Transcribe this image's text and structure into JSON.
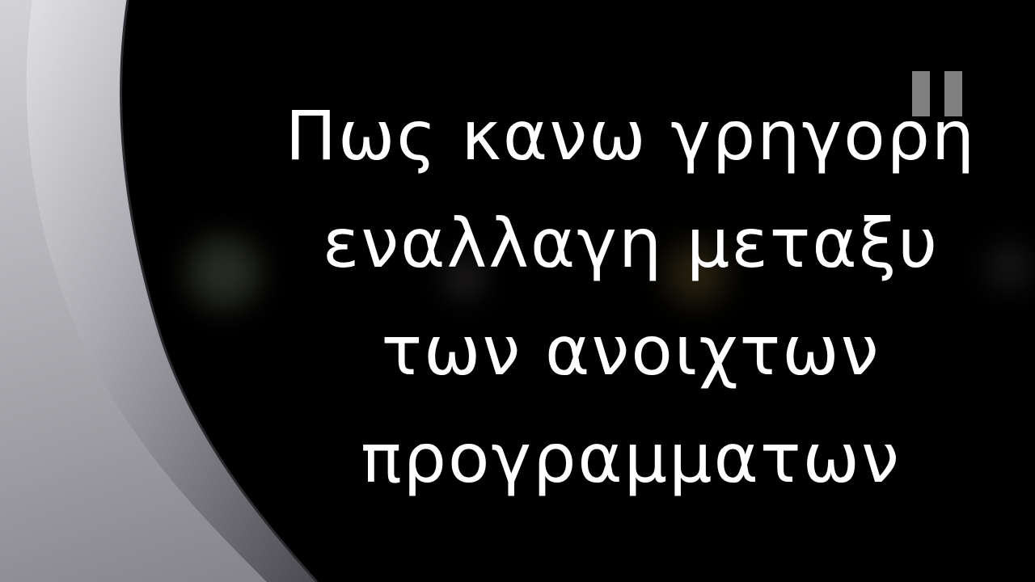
{
  "slide": {
    "title_lines": [
      "Πως κανω γρηγορη",
      "εναλλαγη μεταξυ",
      "των ανοιχτων",
      "προγραμματων"
    ]
  },
  "decor": {
    "background_color": "#000000",
    "swoosh_colors": [
      "#d8d8dc",
      "#9a9aa0",
      "#5c5c62"
    ],
    "text_color": "#ffffff"
  },
  "icons": {
    "pause": "pause-icon"
  }
}
